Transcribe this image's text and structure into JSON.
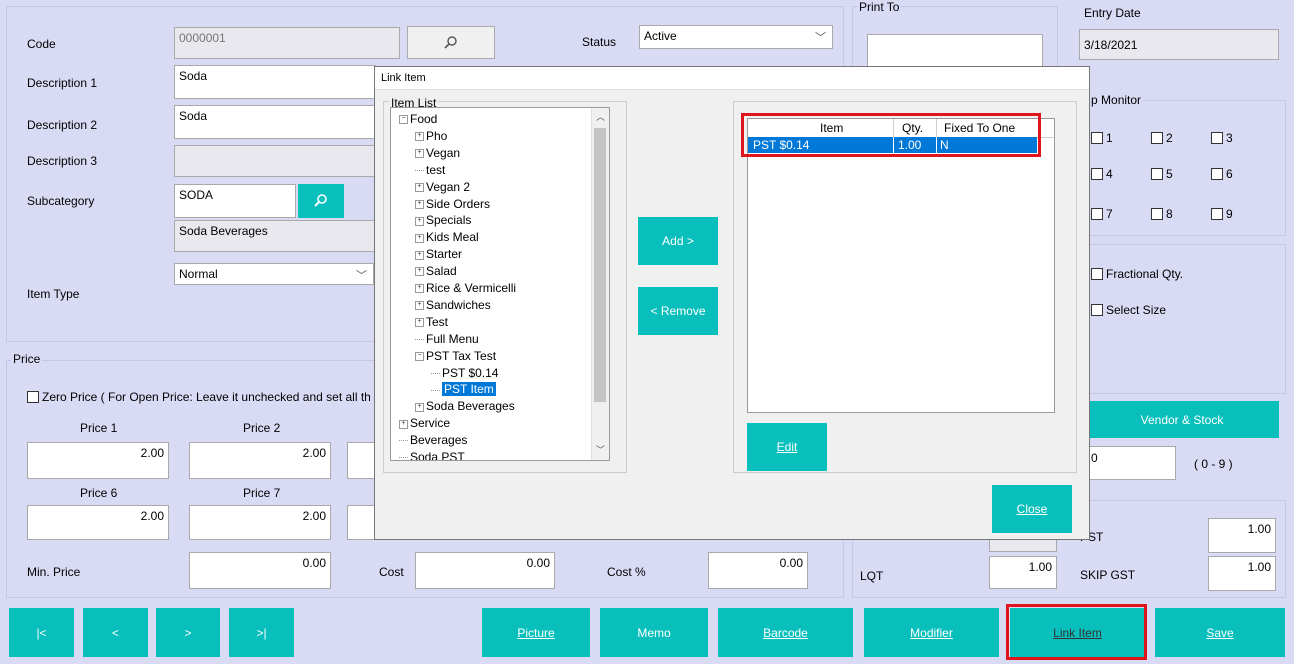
{
  "form": {
    "code_label": "Code",
    "code_value": "0000001",
    "desc1_label": "Description 1",
    "desc1_value": "Soda",
    "desc2_label": "Description 2",
    "desc2_value": "Soda",
    "desc3_label": "Description 3",
    "desc3_value": "",
    "subcategory_label": "Subcategory",
    "subcategory_value": "SODA",
    "subcategory_name": "Soda Beverages",
    "item_type_label": "Item Type",
    "item_type_value": "Normal",
    "status_label": "Status",
    "status_value": "Active",
    "print_to_label": "Print To",
    "entry_date_label": "Entry Date",
    "entry_date_value": "3/18/2021",
    "monitor_label": "Monitor",
    "monitor_prefix": "p",
    "monitors": [
      "1",
      "2",
      "3",
      "4",
      "5",
      "6",
      "7",
      "8",
      "9"
    ],
    "fractional_qty_label": "Fractional Qty.",
    "select_size_label": "Select Size",
    "vendor_stock_label": "Vendor & Stock",
    "range_value": "0",
    "range_hint": "( 0 - 9 )"
  },
  "price": {
    "group_label": "Price",
    "zero_price_label": "Zero Price ( For Open Price: Leave it unchecked and set all th",
    "price1_label": "Price 1",
    "price2_label": "Price 2",
    "price6_label": "Price 6",
    "price7_label": "Price 7",
    "price1": "2.00",
    "price2": "2.00",
    "price6": "2.00",
    "price7": "2.00",
    "min_price_label": "Min. Price",
    "min_price": "0.00",
    "cost_label": "Cost",
    "cost": "0.00",
    "cost_pct_label": "Cost %",
    "cost_pct": "0.00",
    "lqt_label": "LQT",
    "lqt": "1.00",
    "pst_label": "PST",
    "pst": "1.00",
    "skip_gst_label": "SKIP GST",
    "skip_gst": "1.00"
  },
  "dialog": {
    "title": "Link Item",
    "item_list_label": "Item List",
    "add_label": "Add >",
    "add_key": "A",
    "remove_label": "< Remove",
    "remove_key": "R",
    "edit_label": "Edit",
    "close_label": "Close",
    "tree": [
      {
        "label": "Food",
        "sign": "−",
        "level": 0
      },
      {
        "label": "Pho",
        "sign": "+",
        "level": 1
      },
      {
        "label": "Vegan",
        "sign": "+",
        "level": 1
      },
      {
        "label": "test",
        "sign": "",
        "level": 1
      },
      {
        "label": "Vegan 2",
        "sign": "+",
        "level": 1
      },
      {
        "label": "Side Orders",
        "sign": "+",
        "level": 1
      },
      {
        "label": "Specials",
        "sign": "+",
        "level": 1
      },
      {
        "label": "Kids Meal",
        "sign": "+",
        "level": 1
      },
      {
        "label": "Starter",
        "sign": "+",
        "level": 1
      },
      {
        "label": "Salad",
        "sign": "+",
        "level": 1
      },
      {
        "label": "Rice & Vermicelli",
        "sign": "+",
        "level": 1
      },
      {
        "label": "Sandwiches",
        "sign": "+",
        "level": 1
      },
      {
        "label": "Test",
        "sign": "+",
        "level": 1
      },
      {
        "label": "Full Menu",
        "sign": "",
        "level": 1
      },
      {
        "label": "PST Tax Test",
        "sign": "−",
        "level": 1
      },
      {
        "label": "PST $0.14",
        "sign": "",
        "level": 2
      },
      {
        "label": "PST Item",
        "sign": "",
        "level": 2,
        "selected": true
      },
      {
        "label": "Soda Beverages",
        "sign": "+",
        "level": 1
      },
      {
        "label": "Service",
        "sign": "+",
        "level": 0
      },
      {
        "label": "Beverages",
        "sign": "",
        "level": 0
      },
      {
        "label": "Soda PST",
        "sign": "",
        "level": 0
      }
    ],
    "grid_headers": [
      "Item",
      "Qty.",
      "Fixed To One"
    ],
    "grid_rows": [
      [
        "PST $0.14",
        "1.00",
        "N"
      ]
    ]
  },
  "bottom_bar": {
    "first": "|<",
    "prev": "<",
    "next": ">",
    "last": ">|",
    "picture": "Picture",
    "memo": "Memo",
    "barcode": "Barcode",
    "modifier": "Modifier",
    "link_item": "Link Item",
    "save": "Save"
  },
  "colors": {
    "background": "#d9dbf5",
    "accent": "#08bfbc",
    "highlight": "#0078d7",
    "annotation": "#e0141c"
  }
}
